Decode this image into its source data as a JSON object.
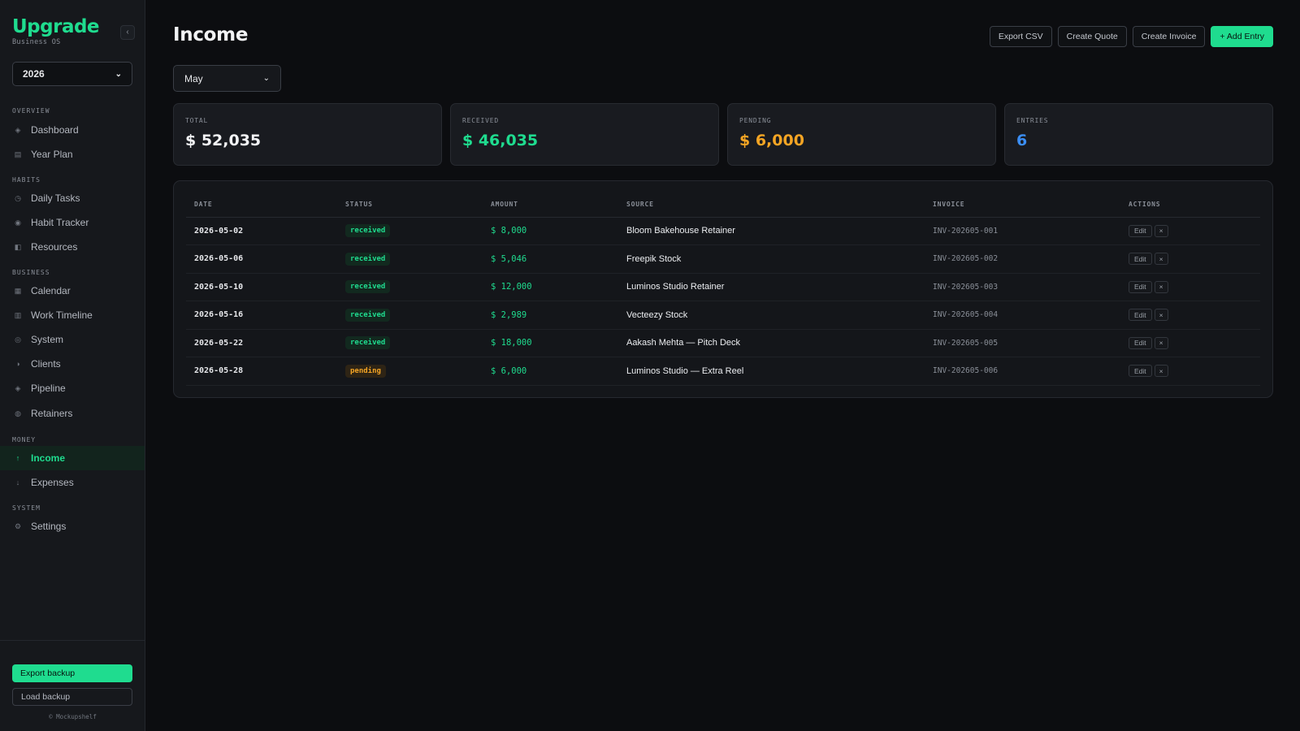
{
  "brand": {
    "name": "Upgrade",
    "subtitle": "Business OS",
    "collapse_icon": "‹"
  },
  "year_select": {
    "value": "2026"
  },
  "nav": {
    "overview_label": "OVERVIEW",
    "habits_label": "HABITS",
    "business_label": "BUSINESS",
    "money_label": "MONEY",
    "system_label": "SYSTEM",
    "items": [
      {
        "label": "Dashboard",
        "icon": "◈"
      },
      {
        "label": "Year Plan",
        "icon": "▤"
      },
      {
        "label": "Daily Tasks",
        "icon": "◷"
      },
      {
        "label": "Habit Tracker",
        "icon": "◉"
      },
      {
        "label": "Resources",
        "icon": "◧"
      },
      {
        "label": "Calendar",
        "icon": "▦"
      },
      {
        "label": "Work Timeline",
        "icon": "▥"
      },
      {
        "label": "System",
        "icon": "◎"
      },
      {
        "label": "Clients",
        "icon": "◑"
      },
      {
        "label": "Pipeline",
        "icon": "◈"
      },
      {
        "label": "Retainers",
        "icon": "◍"
      },
      {
        "label": "Income",
        "icon": "↑",
        "active": true
      },
      {
        "label": "Expenses",
        "icon": "↓"
      },
      {
        "label": "Settings",
        "icon": "⚙"
      }
    ]
  },
  "sidebar_bottom": {
    "export_backup": "Export backup",
    "load_backup": "Load backup",
    "copyright": "© Mockupshelf"
  },
  "header": {
    "title": "Income",
    "export_csv": "Export CSV",
    "create_quote": "Create Quote",
    "create_invoice": "Create Invoice",
    "add_entry": "+ Add Entry"
  },
  "month_select": {
    "value": "May"
  },
  "stats": {
    "total_label": "TOTAL",
    "total_value": "$ 52,035",
    "received_label": "RECEIVED",
    "received_value": "$ 46,035",
    "pending_label": "PENDING",
    "pending_value": "$ 6,000",
    "entries_label": "ENTRIES",
    "entries_value": "6"
  },
  "table": {
    "columns": [
      "DATE",
      "STATUS",
      "AMOUNT",
      "SOURCE",
      "INVOICE",
      "ACTIONS"
    ],
    "edit_label": "Edit",
    "delete_label": "×",
    "rows": [
      {
        "date": "2026-05-02",
        "status": "received",
        "amount": "$ 8,000",
        "source": "Bloom Bakehouse Retainer",
        "invoice": "INV-202605-001"
      },
      {
        "date": "2026-05-06",
        "status": "received",
        "amount": "$ 5,046",
        "source": "Freepik Stock",
        "invoice": "INV-202605-002"
      },
      {
        "date": "2026-05-10",
        "status": "received",
        "amount": "$ 12,000",
        "source": "Luminos Studio Retainer",
        "invoice": "INV-202605-003"
      },
      {
        "date": "2026-05-16",
        "status": "received",
        "amount": "$ 2,989",
        "source": "Vecteezy Stock",
        "invoice": "INV-202605-004"
      },
      {
        "date": "2026-05-22",
        "status": "received",
        "amount": "$ 18,000",
        "source": "Aakash Mehta — Pitch Deck",
        "invoice": "INV-202605-005"
      },
      {
        "date": "2026-05-28",
        "status": "pending",
        "amount": "$ 6,000",
        "source": "Luminos Studio — Extra Reel",
        "invoice": "INV-202605-006"
      }
    ]
  },
  "colors": {
    "accent": "#1fdc8f",
    "pending": "#f5a524",
    "entries": "#3b8ef5",
    "background": "#0c0d10",
    "sidebar": "#16181c"
  }
}
